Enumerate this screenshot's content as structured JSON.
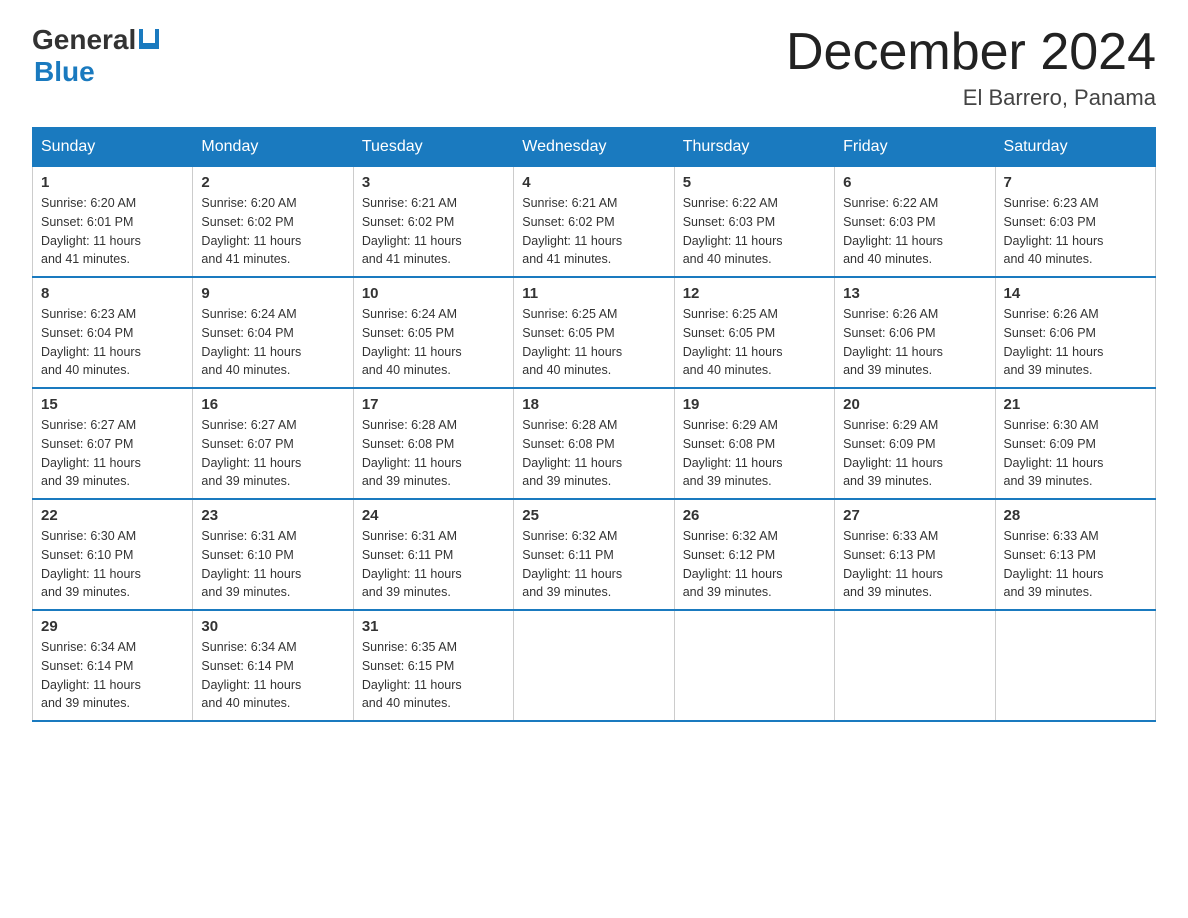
{
  "logo": {
    "general": "General",
    "blue": "Blue"
  },
  "title": "December 2024",
  "location": "El Barrero, Panama",
  "days_of_week": [
    "Sunday",
    "Monday",
    "Tuesday",
    "Wednesday",
    "Thursday",
    "Friday",
    "Saturday"
  ],
  "weeks": [
    [
      {
        "day": "1",
        "sunrise": "6:20 AM",
        "sunset": "6:01 PM",
        "daylight": "11 hours and 41 minutes."
      },
      {
        "day": "2",
        "sunrise": "6:20 AM",
        "sunset": "6:02 PM",
        "daylight": "11 hours and 41 minutes."
      },
      {
        "day": "3",
        "sunrise": "6:21 AM",
        "sunset": "6:02 PM",
        "daylight": "11 hours and 41 minutes."
      },
      {
        "day": "4",
        "sunrise": "6:21 AM",
        "sunset": "6:02 PM",
        "daylight": "11 hours and 41 minutes."
      },
      {
        "day": "5",
        "sunrise": "6:22 AM",
        "sunset": "6:03 PM",
        "daylight": "11 hours and 40 minutes."
      },
      {
        "day": "6",
        "sunrise": "6:22 AM",
        "sunset": "6:03 PM",
        "daylight": "11 hours and 40 minutes."
      },
      {
        "day": "7",
        "sunrise": "6:23 AM",
        "sunset": "6:03 PM",
        "daylight": "11 hours and 40 minutes."
      }
    ],
    [
      {
        "day": "8",
        "sunrise": "6:23 AM",
        "sunset": "6:04 PM",
        "daylight": "11 hours and 40 minutes."
      },
      {
        "day": "9",
        "sunrise": "6:24 AM",
        "sunset": "6:04 PM",
        "daylight": "11 hours and 40 minutes."
      },
      {
        "day": "10",
        "sunrise": "6:24 AM",
        "sunset": "6:05 PM",
        "daylight": "11 hours and 40 minutes."
      },
      {
        "day": "11",
        "sunrise": "6:25 AM",
        "sunset": "6:05 PM",
        "daylight": "11 hours and 40 minutes."
      },
      {
        "day": "12",
        "sunrise": "6:25 AM",
        "sunset": "6:05 PM",
        "daylight": "11 hours and 40 minutes."
      },
      {
        "day": "13",
        "sunrise": "6:26 AM",
        "sunset": "6:06 PM",
        "daylight": "11 hours and 39 minutes."
      },
      {
        "day": "14",
        "sunrise": "6:26 AM",
        "sunset": "6:06 PM",
        "daylight": "11 hours and 39 minutes."
      }
    ],
    [
      {
        "day": "15",
        "sunrise": "6:27 AM",
        "sunset": "6:07 PM",
        "daylight": "11 hours and 39 minutes."
      },
      {
        "day": "16",
        "sunrise": "6:27 AM",
        "sunset": "6:07 PM",
        "daylight": "11 hours and 39 minutes."
      },
      {
        "day": "17",
        "sunrise": "6:28 AM",
        "sunset": "6:08 PM",
        "daylight": "11 hours and 39 minutes."
      },
      {
        "day": "18",
        "sunrise": "6:28 AM",
        "sunset": "6:08 PM",
        "daylight": "11 hours and 39 minutes."
      },
      {
        "day": "19",
        "sunrise": "6:29 AM",
        "sunset": "6:08 PM",
        "daylight": "11 hours and 39 minutes."
      },
      {
        "day": "20",
        "sunrise": "6:29 AM",
        "sunset": "6:09 PM",
        "daylight": "11 hours and 39 minutes."
      },
      {
        "day": "21",
        "sunrise": "6:30 AM",
        "sunset": "6:09 PM",
        "daylight": "11 hours and 39 minutes."
      }
    ],
    [
      {
        "day": "22",
        "sunrise": "6:30 AM",
        "sunset": "6:10 PM",
        "daylight": "11 hours and 39 minutes."
      },
      {
        "day": "23",
        "sunrise": "6:31 AM",
        "sunset": "6:10 PM",
        "daylight": "11 hours and 39 minutes."
      },
      {
        "day": "24",
        "sunrise": "6:31 AM",
        "sunset": "6:11 PM",
        "daylight": "11 hours and 39 minutes."
      },
      {
        "day": "25",
        "sunrise": "6:32 AM",
        "sunset": "6:11 PM",
        "daylight": "11 hours and 39 minutes."
      },
      {
        "day": "26",
        "sunrise": "6:32 AM",
        "sunset": "6:12 PM",
        "daylight": "11 hours and 39 minutes."
      },
      {
        "day": "27",
        "sunrise": "6:33 AM",
        "sunset": "6:13 PM",
        "daylight": "11 hours and 39 minutes."
      },
      {
        "day": "28",
        "sunrise": "6:33 AM",
        "sunset": "6:13 PM",
        "daylight": "11 hours and 39 minutes."
      }
    ],
    [
      {
        "day": "29",
        "sunrise": "6:34 AM",
        "sunset": "6:14 PM",
        "daylight": "11 hours and 39 minutes."
      },
      {
        "day": "30",
        "sunrise": "6:34 AM",
        "sunset": "6:14 PM",
        "daylight": "11 hours and 40 minutes."
      },
      {
        "day": "31",
        "sunrise": "6:35 AM",
        "sunset": "6:15 PM",
        "daylight": "11 hours and 40 minutes."
      },
      null,
      null,
      null,
      null
    ]
  ],
  "labels": {
    "sunrise": "Sunrise:",
    "sunset": "Sunset:",
    "daylight": "Daylight:"
  },
  "colors": {
    "header_bg": "#1a7abf",
    "border": "#1a7abf",
    "text": "#333333"
  }
}
